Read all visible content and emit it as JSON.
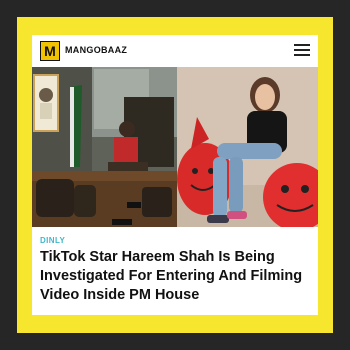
{
  "brand": {
    "logo_letter": "M",
    "name": "MANGOBAAZ"
  },
  "article": {
    "category": "DINLY",
    "headline": "TikTok Star Hareem Shah Is Being Investigated For Entering And Filming Video Inside PM House"
  },
  "colors": {
    "frame": "#f7e62e",
    "background": "#262626",
    "category": "#3fb8c9",
    "logo": "#f2c300"
  },
  "icons": {
    "menu": "hamburger-icon"
  }
}
